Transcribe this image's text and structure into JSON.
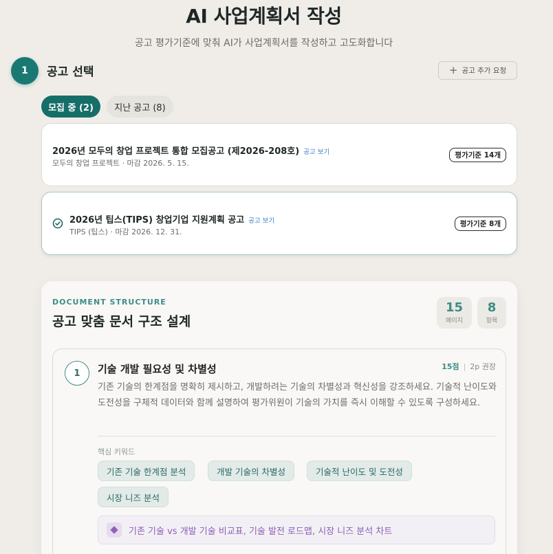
{
  "header": {
    "title": "AI 사업계획서 작성",
    "subtitle": "공고 평가기준에 맞춰 AI가 사업계획서를 작성하고 고도화합니다"
  },
  "step": {
    "number": "1",
    "title": "공고 선택",
    "add_button_label": "공고 추가 요청",
    "add_icon": "plus-icon"
  },
  "tabs": [
    {
      "label": "모집 중 (2)",
      "active": true
    },
    {
      "label": "지난 공고 (8)",
      "active": false
    }
  ],
  "notices": [
    {
      "title": "2026년 모두의 창업 프로젝트 통합 모집공고 (제2026-208호)",
      "link_label": "공고 보기",
      "subtitle": "모두의 창업 프로젝트 · 마감 2026. 5. 15.",
      "criteria": "평가기준 14개",
      "selected": false
    },
    {
      "title": "2026년 팁스(TIPS) 창업기업 지원계획 공고",
      "link_label": "공고 보기",
      "subtitle": "TIPS (팁스) · 마감 2026. 12. 31.",
      "criteria": "평가기준 8개",
      "selected": true,
      "icon": "check-circle-icon"
    }
  ],
  "doc": {
    "eyebrow": "DOCUMENT STRUCTURE",
    "heading": "공고 맞춤 문서 구조 설계",
    "stats": [
      {
        "value": "15",
        "label": "페이지"
      },
      {
        "value": "8",
        "label": "항목"
      }
    ],
    "section": {
      "number": "1",
      "title": "기술 개발 필요성 및 차별성",
      "points": "15점",
      "pages": "2p 권장",
      "description": "기존 기술의 한계점을 명확히 제시하고, 개발하려는 기술의 차별성과 혁신성을 강조하세요. 기술적 난이도와 도전성을 구체적 데이터와 함께 설명하여 평가위원이 기술의 가치를 즉시 이해할 수 있도록 구성하세요.",
      "keywords_label": "핵심 키워드",
      "keywords": [
        "기존 기술 한계점 분석",
        "개발 기술의 차별성",
        "기술적 난이도 및 도전성",
        "시장 니즈 분석"
      ],
      "visual_icon": "diamond-icon",
      "visual_text": "기존 기술 vs 개발 기술 비교표, 기술 발전 로드맵, 시장 니즈 분석 차트"
    }
  },
  "colors": {
    "primary": "#1a7873",
    "accent_teal": "#3e8c86",
    "link": "#3a7fc4",
    "visual_purple": "#8e5fb8",
    "background": "#f0ede8"
  }
}
